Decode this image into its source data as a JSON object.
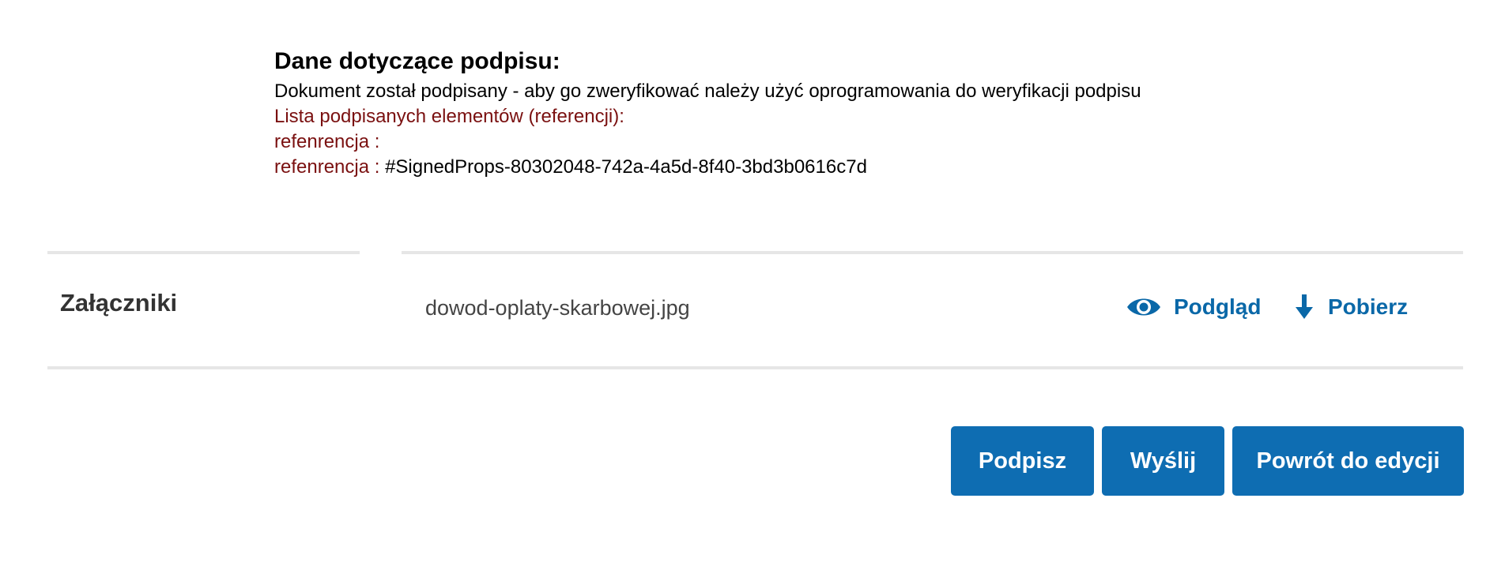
{
  "signature": {
    "title": "Dane dotyczące podpisu:",
    "description": "Dokument został podpisany - aby go zweryfikować należy użyć oprogramowania do weryfikacji podpisu",
    "references_header": "Lista podpisanych elementów (referencji):",
    "references": [
      {
        "label": "refenrencja :",
        "value": ""
      },
      {
        "label": "refenrencja :",
        "value": "#SignedProps-80302048-742a-4a5d-8f40-3bd3b0616c7d"
      }
    ]
  },
  "attachments": {
    "label": "Załączniki",
    "file_name": "dowod-oplaty-skarbowej.jpg",
    "preview_label": "Podgląd",
    "preview_icon": "eye-icon",
    "download_label": "Pobierz",
    "download_icon": "arrow-down-icon"
  },
  "buttons": {
    "sign": "Podpisz",
    "send": "Wyślij",
    "back_to_edit": "Powrót do edycji"
  },
  "colors": {
    "accent": "#0e6db2",
    "link": "#0a68a8",
    "reference_text": "#7a1010",
    "divider": "#e6e6e6"
  }
}
